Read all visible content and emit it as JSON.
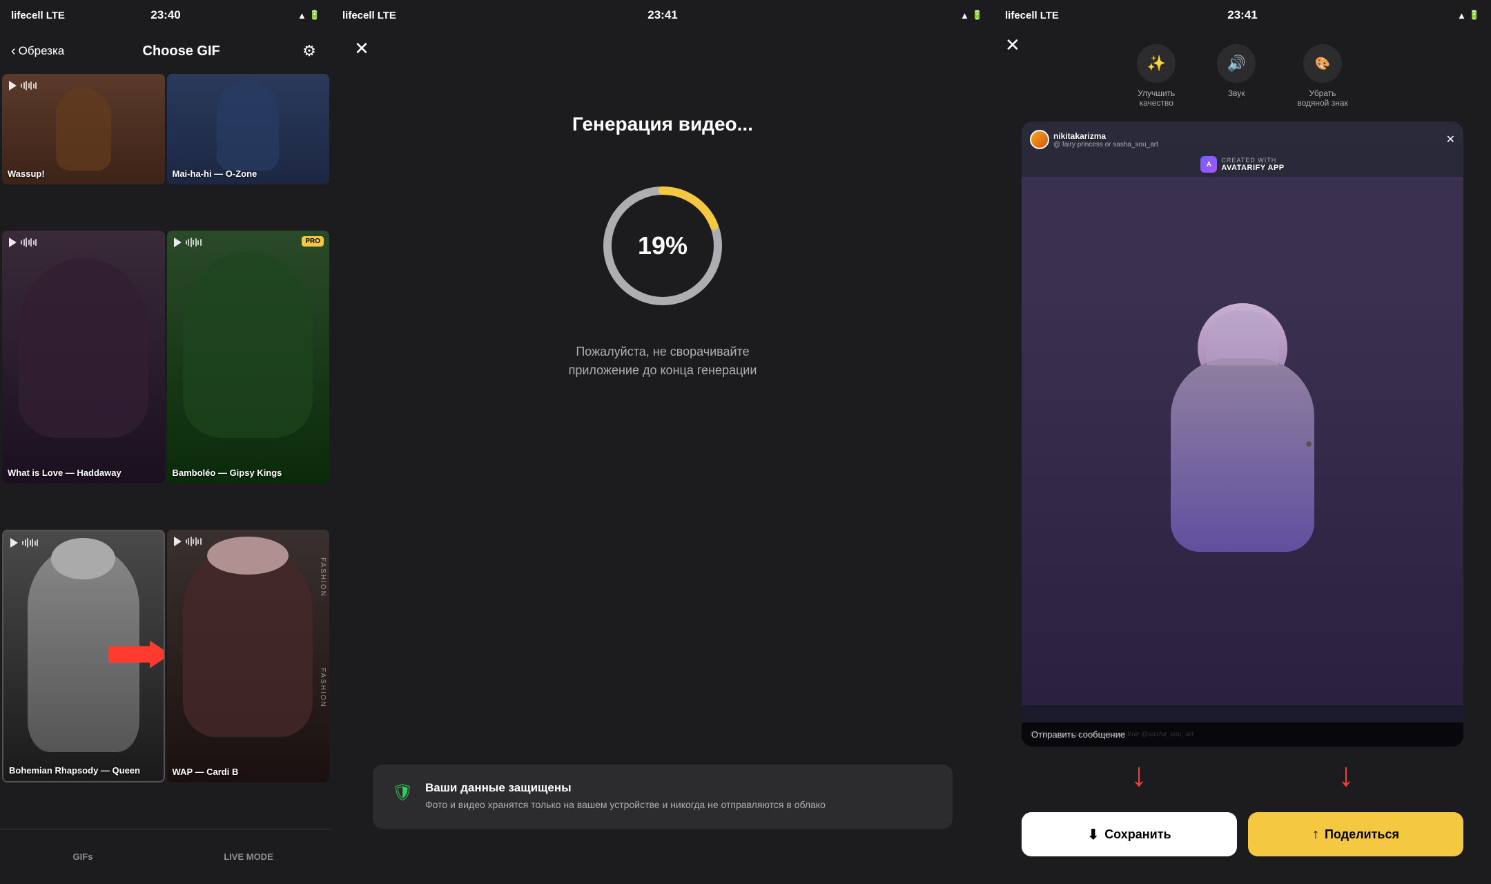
{
  "panel1": {
    "statusBar": {
      "carrier": "lifecell",
      "network": "LTE",
      "time": "23:40"
    },
    "navBack": "Обрезка",
    "navTitle": "Choose GIF",
    "gifItems": [
      {
        "id": "wassup",
        "label": "Wassup!",
        "hasPro": false,
        "colorClass": "gif-wassup",
        "hasArrow": false
      },
      {
        "id": "maihahi",
        "label": "Mai-ha-hi — O-Zone",
        "hasPro": false,
        "colorClass": "gif-maihahi",
        "hasArrow": false
      },
      {
        "id": "whatislove",
        "label": "What is Love — Haddaway",
        "hasPro": false,
        "colorClass": "gif-whatislove",
        "hasArrow": false
      },
      {
        "id": "bamboleo",
        "label": "Bamboléo — Gipsy Kings",
        "hasPro": true,
        "colorClass": "gif-bamboleo",
        "hasArrow": false
      },
      {
        "id": "bohemian",
        "label": "Bohemian Rhapsody — Queen",
        "hasPro": false,
        "colorClass": "gif-bohemian",
        "hasArrow": true
      },
      {
        "id": "wap",
        "label": "WAP — Cardi B",
        "hasPro": false,
        "colorClass": "gif-wap",
        "hasArrow": false
      },
      {
        "id": "gifs",
        "label": "GIFs",
        "hasPro": false,
        "colorClass": "gif-gifs",
        "hasArrow": false
      },
      {
        "id": "live",
        "label": "LIVE MODE",
        "hasPro": false,
        "colorClass": "gif-live",
        "hasArrow": false
      }
    ],
    "bottomTabs": [
      "GIFs",
      "LIVE MODE"
    ]
  },
  "panel2": {
    "statusBar": {
      "carrier": "lifecell",
      "network": "LTE",
      "time": "23:41"
    },
    "title": "Генерация видео...",
    "progress": 19,
    "progressLabel": "19%",
    "subtitle": "Пожалуйста, не сворачивайте\nприложение до конца генерации",
    "dataProtection": {
      "title": "Ваши данные защищены",
      "desc": "Фото и видео хранятся только на вашем устройстве и никогда не отправляются в облако"
    }
  },
  "panel3": {
    "statusBar": {
      "carrier": "lifecell",
      "network": "LTE",
      "time": "23:41"
    },
    "toolbar": [
      {
        "id": "enhance",
        "icon": "✨",
        "label": "Улучшить\nкачество"
      },
      {
        "id": "sound",
        "icon": "🔊",
        "label": "Звук"
      },
      {
        "id": "watermark",
        "icon": "🎨",
        "label": "Убрать\nводяной знак"
      }
    ],
    "video": {
      "username": "nikitakarizma",
      "subline": "@ fairy princess or sasha_sou_art",
      "createdWith": "CREATED WITH",
      "appName": "AVATARIFY APP",
      "caption": "My fairy princess dreams come true @sasha_sou_art",
      "sendMessage": "Отправить сообщение"
    },
    "saveLabel": "Сохранить",
    "shareLabel": "Поделиться"
  }
}
